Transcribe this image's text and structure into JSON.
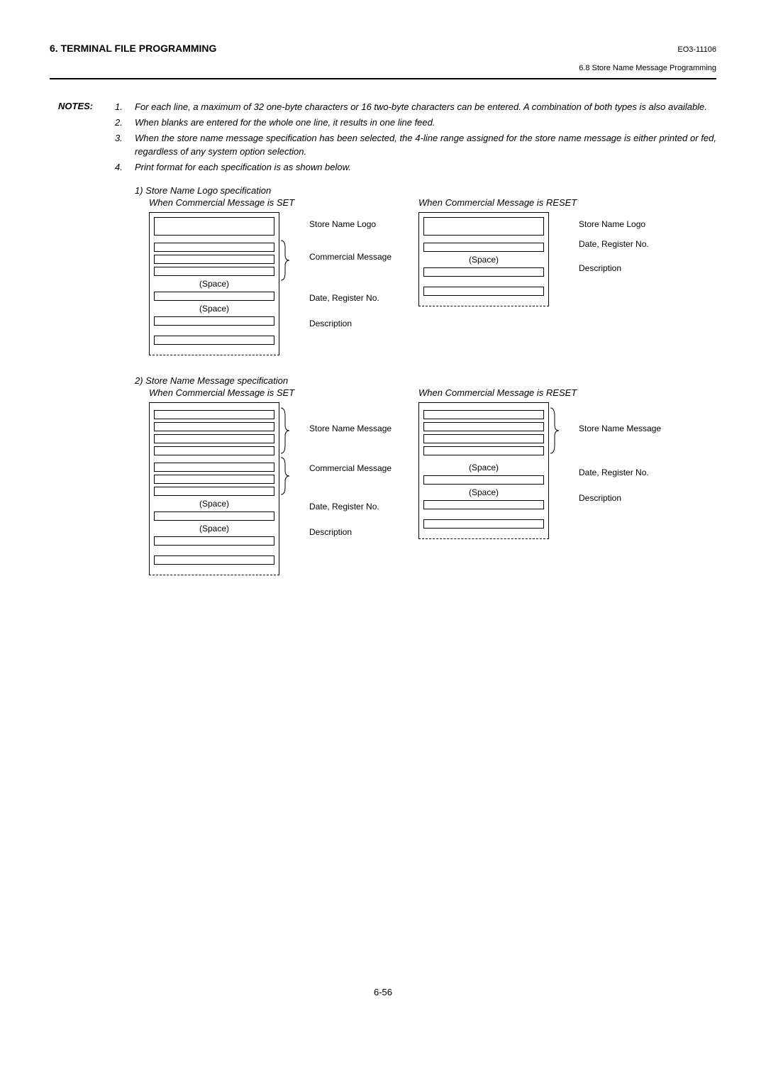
{
  "header": {
    "title": "6. TERMINAL FILE PROGRAMMING",
    "code": "EO3-11106",
    "sub": "6.8 Store Name Message Programming"
  },
  "notes_label": "NOTES:",
  "notes": [
    {
      "num": "1.",
      "text": "For each line, a maximum of 32 one-byte characters or 16 two-byte characters can be entered. A combination of both types is also available."
    },
    {
      "num": "2.",
      "text": "When blanks are entered for the whole one line, it results in one line feed."
    },
    {
      "num": "3.",
      "text": "When the store name message specification has been selected, the 4-line range assigned for the store name message is either printed or fed, regardless of any system option selection."
    },
    {
      "num": "4.",
      "text": "Print format for each specification is as shown below."
    }
  ],
  "spec1_title": "1) Store Name Logo specification",
  "spec2_title": "2) Store Name Message specification",
  "sub_set": "When Commercial Message is SET",
  "sub_reset": "When Commercial Message is RESET",
  "labels": {
    "store_logo": "Store Name Logo",
    "store_msg": "Store Name Message",
    "commercial": "Commercial Message",
    "date_reg": "Date, Register No.",
    "description": "Description",
    "space": "(Space)"
  },
  "page_num": "6-56"
}
